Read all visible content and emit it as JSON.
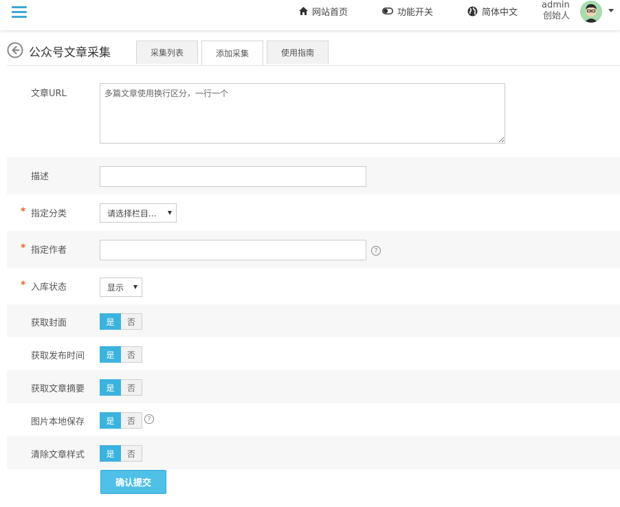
{
  "header": {
    "nav": [
      {
        "label": "网站首页",
        "icon": "home-icon"
      },
      {
        "label": "功能开关",
        "icon": "toggle-icon"
      },
      {
        "label": "简体中文",
        "icon": "globe-icon"
      }
    ],
    "user": {
      "name": "admin",
      "role": "创始人"
    }
  },
  "page": {
    "title": "公众号文章采集",
    "tabs": [
      "采集列表",
      "添加采集",
      "使用指南"
    ],
    "active_tab": "添加采集"
  },
  "form": {
    "url_label": "文章URL",
    "url_placeholder": "多篇文章使用换行区分，一行一个",
    "desc_label": "描述",
    "category_label": "指定分类",
    "category_value": "请选择栏目...",
    "author_label": "指定作者",
    "status_label": "入库状态",
    "status_value": "显示",
    "required_mark": "*",
    "help_mark": "?",
    "toggles": [
      {
        "label": "获取封面",
        "yes": "是",
        "no": "否"
      },
      {
        "label": "获取发布时间",
        "yes": "是",
        "no": "否"
      },
      {
        "label": "获取文章摘要",
        "yes": "是",
        "no": "否"
      },
      {
        "label": "图片本地保存",
        "yes": "是",
        "no": "否"
      },
      {
        "label": "清除文章样式",
        "yes": "是",
        "no": "否"
      }
    ],
    "submit_label": "确认提交"
  },
  "colors": {
    "accent": "#3bb3de",
    "required": "#e8642b",
    "menu": "#3aa7d6"
  }
}
